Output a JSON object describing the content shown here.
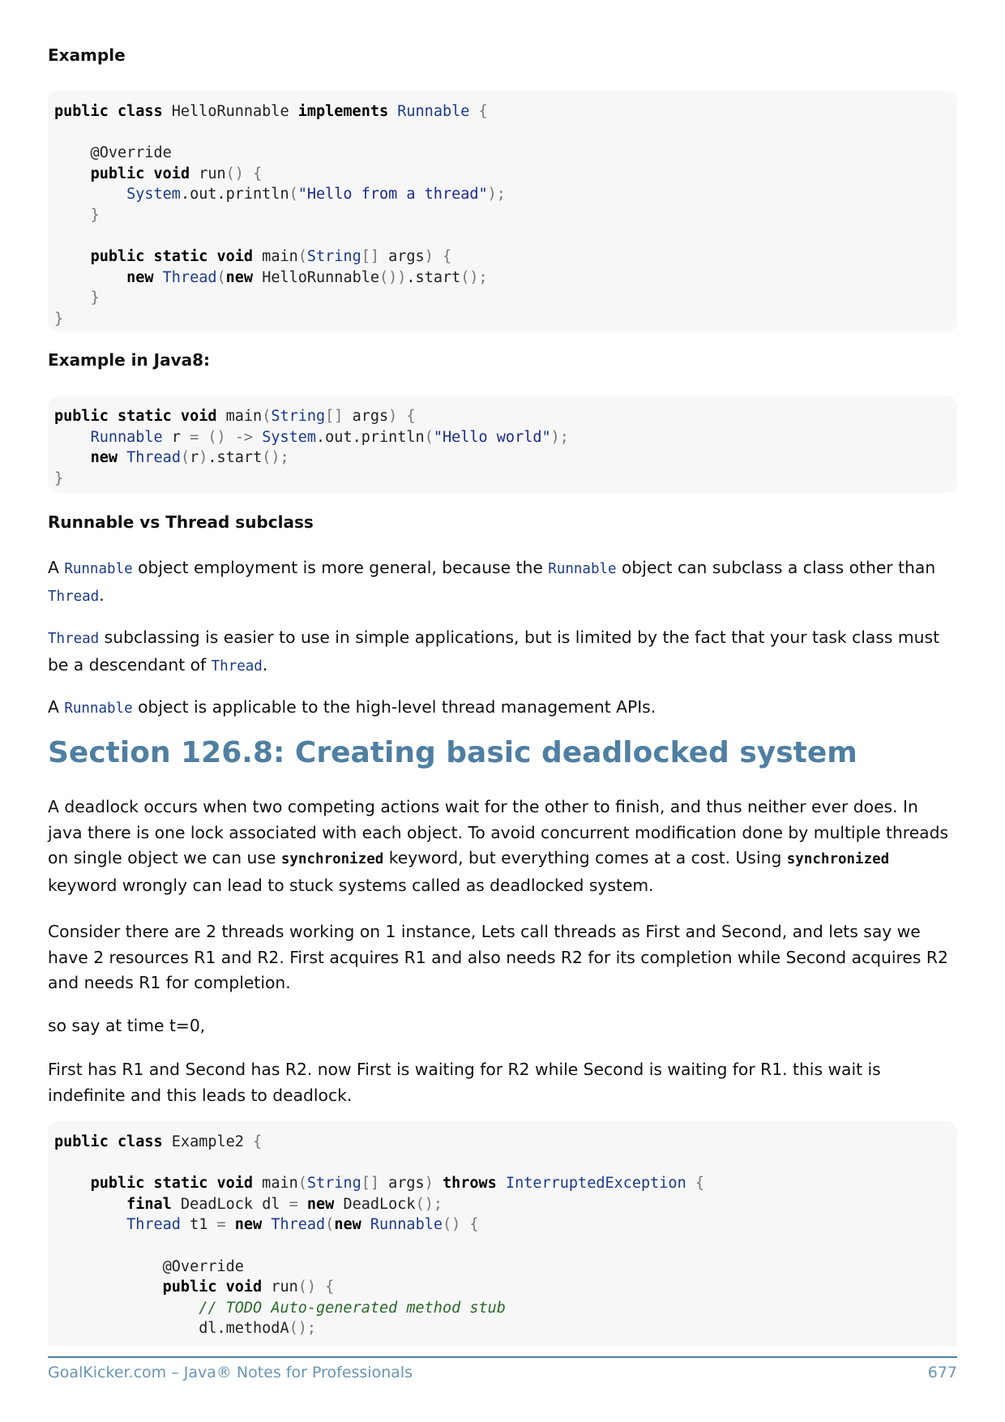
{
  "heading1": "Example",
  "code1": [
    [
      "public class",
      " HelloRunnable ",
      "implements",
      " ",
      "Runnable",
      " {"
    ],
    [],
    [
      "    @Override"
    ],
    [
      "    ",
      "public void",
      " run() {"
    ],
    [
      "        ",
      "System",
      ".out.println(",
      "\"Hello from a thread\"",
      ");"
    ],
    [
      "    }"
    ],
    [],
    [
      "    ",
      "public static void",
      " main(",
      "String",
      "[] args) {"
    ],
    [
      "        ",
      "new",
      " ",
      "Thread",
      "(",
      "new",
      " HelloRunnable()).start();"
    ],
    [
      "    }"
    ],
    [
      "}"
    ]
  ],
  "heading2": "Example in Java8:",
  "heading3": "Runnable vs Thread subclass",
  "para1": {
    "a": "A ",
    "c1": "Runnable",
    "b": " object employment is more general, because the ",
    "c2": "Runnable",
    "c": " object can subclass a class other than ",
    "c3": "Thread",
    "d": "."
  },
  "para2": {
    "c1": "Thread",
    "a": " subclassing is easier to use in simple applications, but is limited by the fact that your task class must be a descendant of ",
    "c2": "Thread",
    "b": "."
  },
  "para3": {
    "a": "A ",
    "c1": "Runnable",
    "b": " object is applicable to the high-level thread management APIs."
  },
  "section_title": "Section 126.8: Creating basic deadlocked system",
  "para4": {
    "a": "A deadlock occurs when two competing actions wait for the other to finish, and thus neither ever does. In java there is one lock associated with each object. To avoid concurrent modification done by multiple threads on single object we can use ",
    "c1": "synchronized",
    "b": " keyword, but everything comes at a cost. Using ",
    "c2": "synchronized",
    "c": " keyword wrongly can lead to stuck systems called as deadlocked system."
  },
  "para5": "Consider there are 2 threads working on 1 instance, Lets call threads as First and Second, and lets say we have 2 resources R1 and R2. First acquires R1 and also needs R2 for its completion while Second acquires R2 and needs R1 for completion.",
  "para6": "so say at time t=0,",
  "para7": "First has R1 and Second has R2. now First is waiting for R2 while Second is waiting for R1. this wait is indefinite and this leads to deadlock.",
  "footer": {
    "left": "GoalKicker.com – Java® Notes for Professionals",
    "page": "677"
  }
}
